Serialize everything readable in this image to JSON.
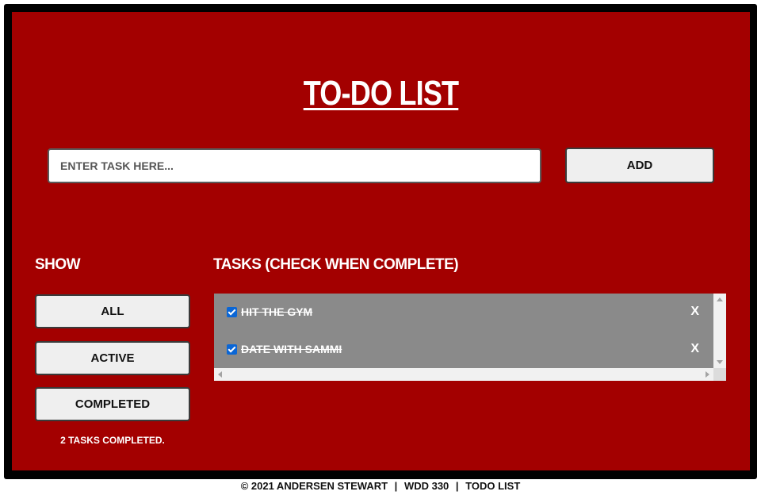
{
  "app": {
    "title": "TO-DO LIST"
  },
  "input": {
    "placeholder": "ENTER TASK HERE...",
    "value": ""
  },
  "buttons": {
    "add_label": "ADD"
  },
  "filters": {
    "heading": "SHOW",
    "items": [
      {
        "label": "ALL"
      },
      {
        "label": "ACTIVE"
      },
      {
        "label": "COMPLETED"
      }
    ],
    "completed_count": "2 TASKS COMPLETED."
  },
  "tasks": {
    "heading": "TASKS (CHECK WHEN COMPLETE)",
    "items": [
      {
        "text": "HIT THE GYM",
        "completed": true,
        "delete_label": "X"
      },
      {
        "text": "DATE WITH SAMMI",
        "completed": true,
        "delete_label": "X"
      }
    ]
  },
  "footer": {
    "copyright": "© 2021 ANDERSEN STEWART",
    "course": "WDD 330",
    "project": "TODO LIST",
    "separator": "|"
  },
  "colors": {
    "panel_bg": "#a30000",
    "frame": "#000000",
    "task_list_bg": "#8a8a8a",
    "checkbox": "#0a66d6"
  }
}
